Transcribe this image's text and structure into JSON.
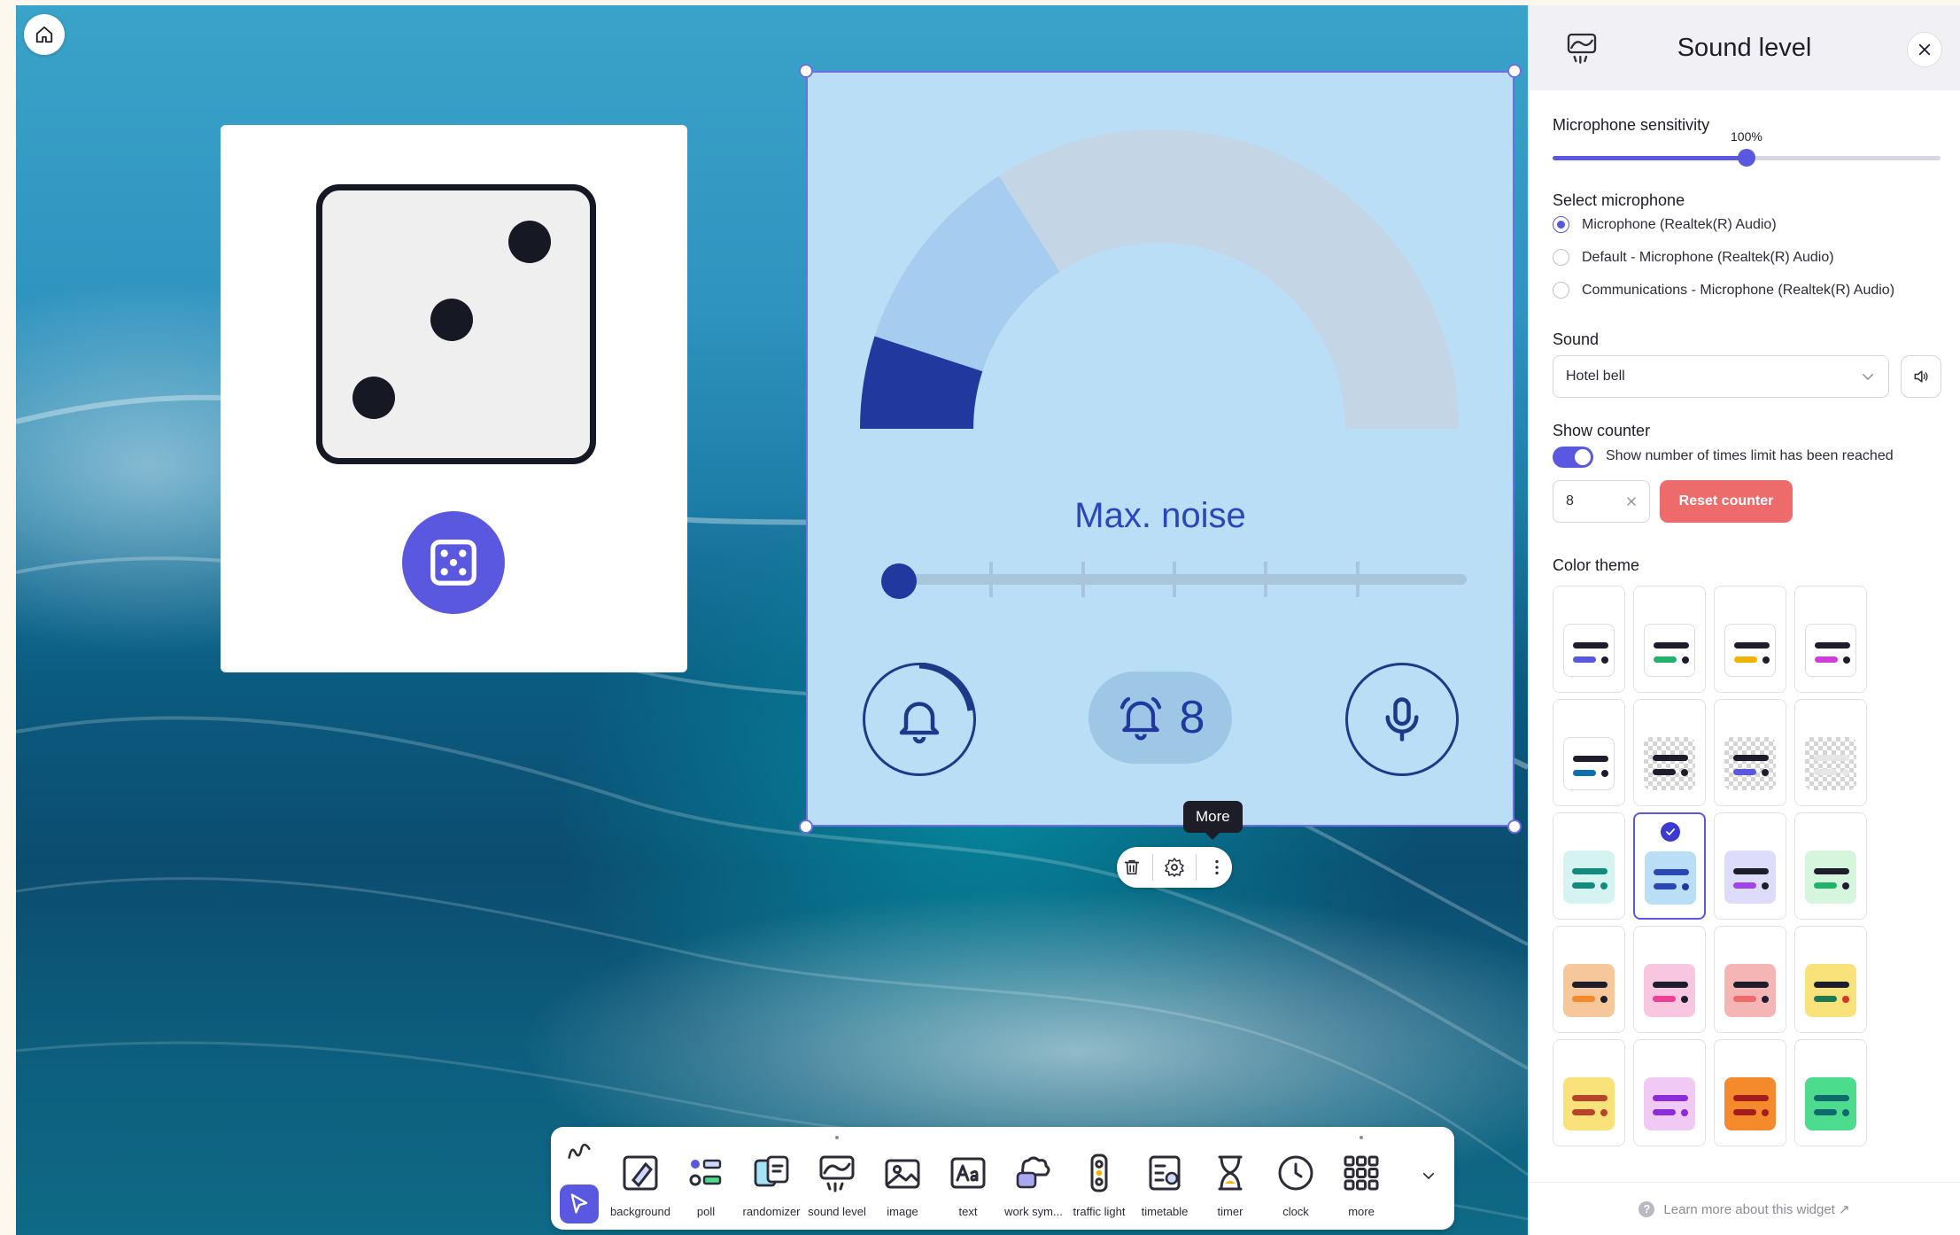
{
  "canvas": {
    "dice": {
      "face_value": 3
    },
    "sound_widget": {
      "label": "Max. noise",
      "counter_value": "8",
      "gauge_level": 0.2,
      "max_noise_level": 0,
      "max_noise_steps": 7
    },
    "tooltip": "More"
  },
  "toolbar": {
    "items": [
      {
        "label": "background",
        "icon": "background-icon"
      },
      {
        "label": "poll",
        "icon": "poll-icon"
      },
      {
        "label": "randomizer",
        "icon": "randomizer-icon"
      },
      {
        "label": "sound level",
        "icon": "sound-level-icon"
      },
      {
        "label": "image",
        "icon": "image-icon"
      },
      {
        "label": "text",
        "icon": "text-icon"
      },
      {
        "label": "work sym...",
        "icon": "work-symbols-icon"
      },
      {
        "label": "traffic light",
        "icon": "traffic-light-icon"
      },
      {
        "label": "timetable",
        "icon": "timetable-icon"
      },
      {
        "label": "timer",
        "icon": "hourglass-icon"
      },
      {
        "label": "clock",
        "icon": "clock-icon"
      },
      {
        "label": "more",
        "icon": "grid-icon"
      }
    ]
  },
  "panel": {
    "title": "Sound level",
    "sensitivity": {
      "label": "Microphone sensitivity",
      "value": "100%",
      "level": 0.5
    },
    "microphone": {
      "label": "Select microphone",
      "options": [
        "Microphone (Realtek(R) Audio)",
        "Default - Microphone (Realtek(R) Audio)",
        "Communications - Microphone (Realtek(R) Audio)"
      ],
      "selected_index": 0
    },
    "sound": {
      "label": "Sound",
      "value": "Hotel bell"
    },
    "counter": {
      "label": "Show counter",
      "toggle_label": "Show number of times limit has been reached",
      "toggle_on": true,
      "value": "8",
      "reset_label": "Reset counter"
    },
    "color_theme": {
      "label": "Color theme",
      "selected_index": 9,
      "themes": [
        {
          "card": "#ffffff",
          "accent": "#5a57e0",
          "dot": "#1d1d2b"
        },
        {
          "card": "#ffffff",
          "accent": "#21b36b",
          "dot": "#1d1d2b"
        },
        {
          "card": "#ffffff",
          "accent": "#f2b400",
          "dot": "#1d1d2b"
        },
        {
          "card": "#ffffff",
          "accent": "#d23cd8",
          "dot": "#1d1d2b"
        },
        {
          "card": "#ffffff",
          "accent": "#0f6fae",
          "dot": "#1d1d2b"
        },
        {
          "card": "checker",
          "accent": "#1d1d2b",
          "dot": "#1d1d2b"
        },
        {
          "card": "checker",
          "accent": "#5a57e0",
          "dot": "#1d1d2b"
        },
        {
          "card": "checker",
          "accent": "#e6e6e6",
          "dot": "#e6e6e6"
        },
        {
          "card": "#d5f4f1",
          "accent": "#138a7e",
          "dot": "#138a7e"
        },
        {
          "card": "#b9def5",
          "accent": "#2a47b8",
          "dot": "#21399e"
        },
        {
          "card": "#dedcfb",
          "accent": "#a046e6",
          "dot": "#1d1d2b"
        },
        {
          "card": "#d6f5dd",
          "accent": "#21b36b",
          "dot": "#1d1d2b"
        },
        {
          "card": "#f6c79a",
          "accent": "#f58a2d",
          "dot": "#1d1d2b"
        },
        {
          "card": "#f8c6de",
          "accent": "#ef3f94",
          "dot": "#1d1d2b"
        },
        {
          "card": "#f5b5b5",
          "accent": "#ee6b6b",
          "dot": "#1d1d2b"
        },
        {
          "card": "#f9e27a",
          "accent": "#1f7a52",
          "dot": "#d6332a"
        },
        {
          "card": "#f9e27a",
          "accent": "#b8432c",
          "dot": "#b8432c"
        },
        {
          "card": "#f1c9f5",
          "accent": "#8c2bd8",
          "dot": "#8c2bd8"
        },
        {
          "card": "#f58a2d",
          "accent": "#a31d1d",
          "dot": "#a31d1d"
        },
        {
          "card": "#4ddc8e",
          "accent": "#0f6a6e",
          "dot": "#0f6a6e"
        }
      ]
    },
    "footer_link": "Learn more about this widget ↗"
  }
}
